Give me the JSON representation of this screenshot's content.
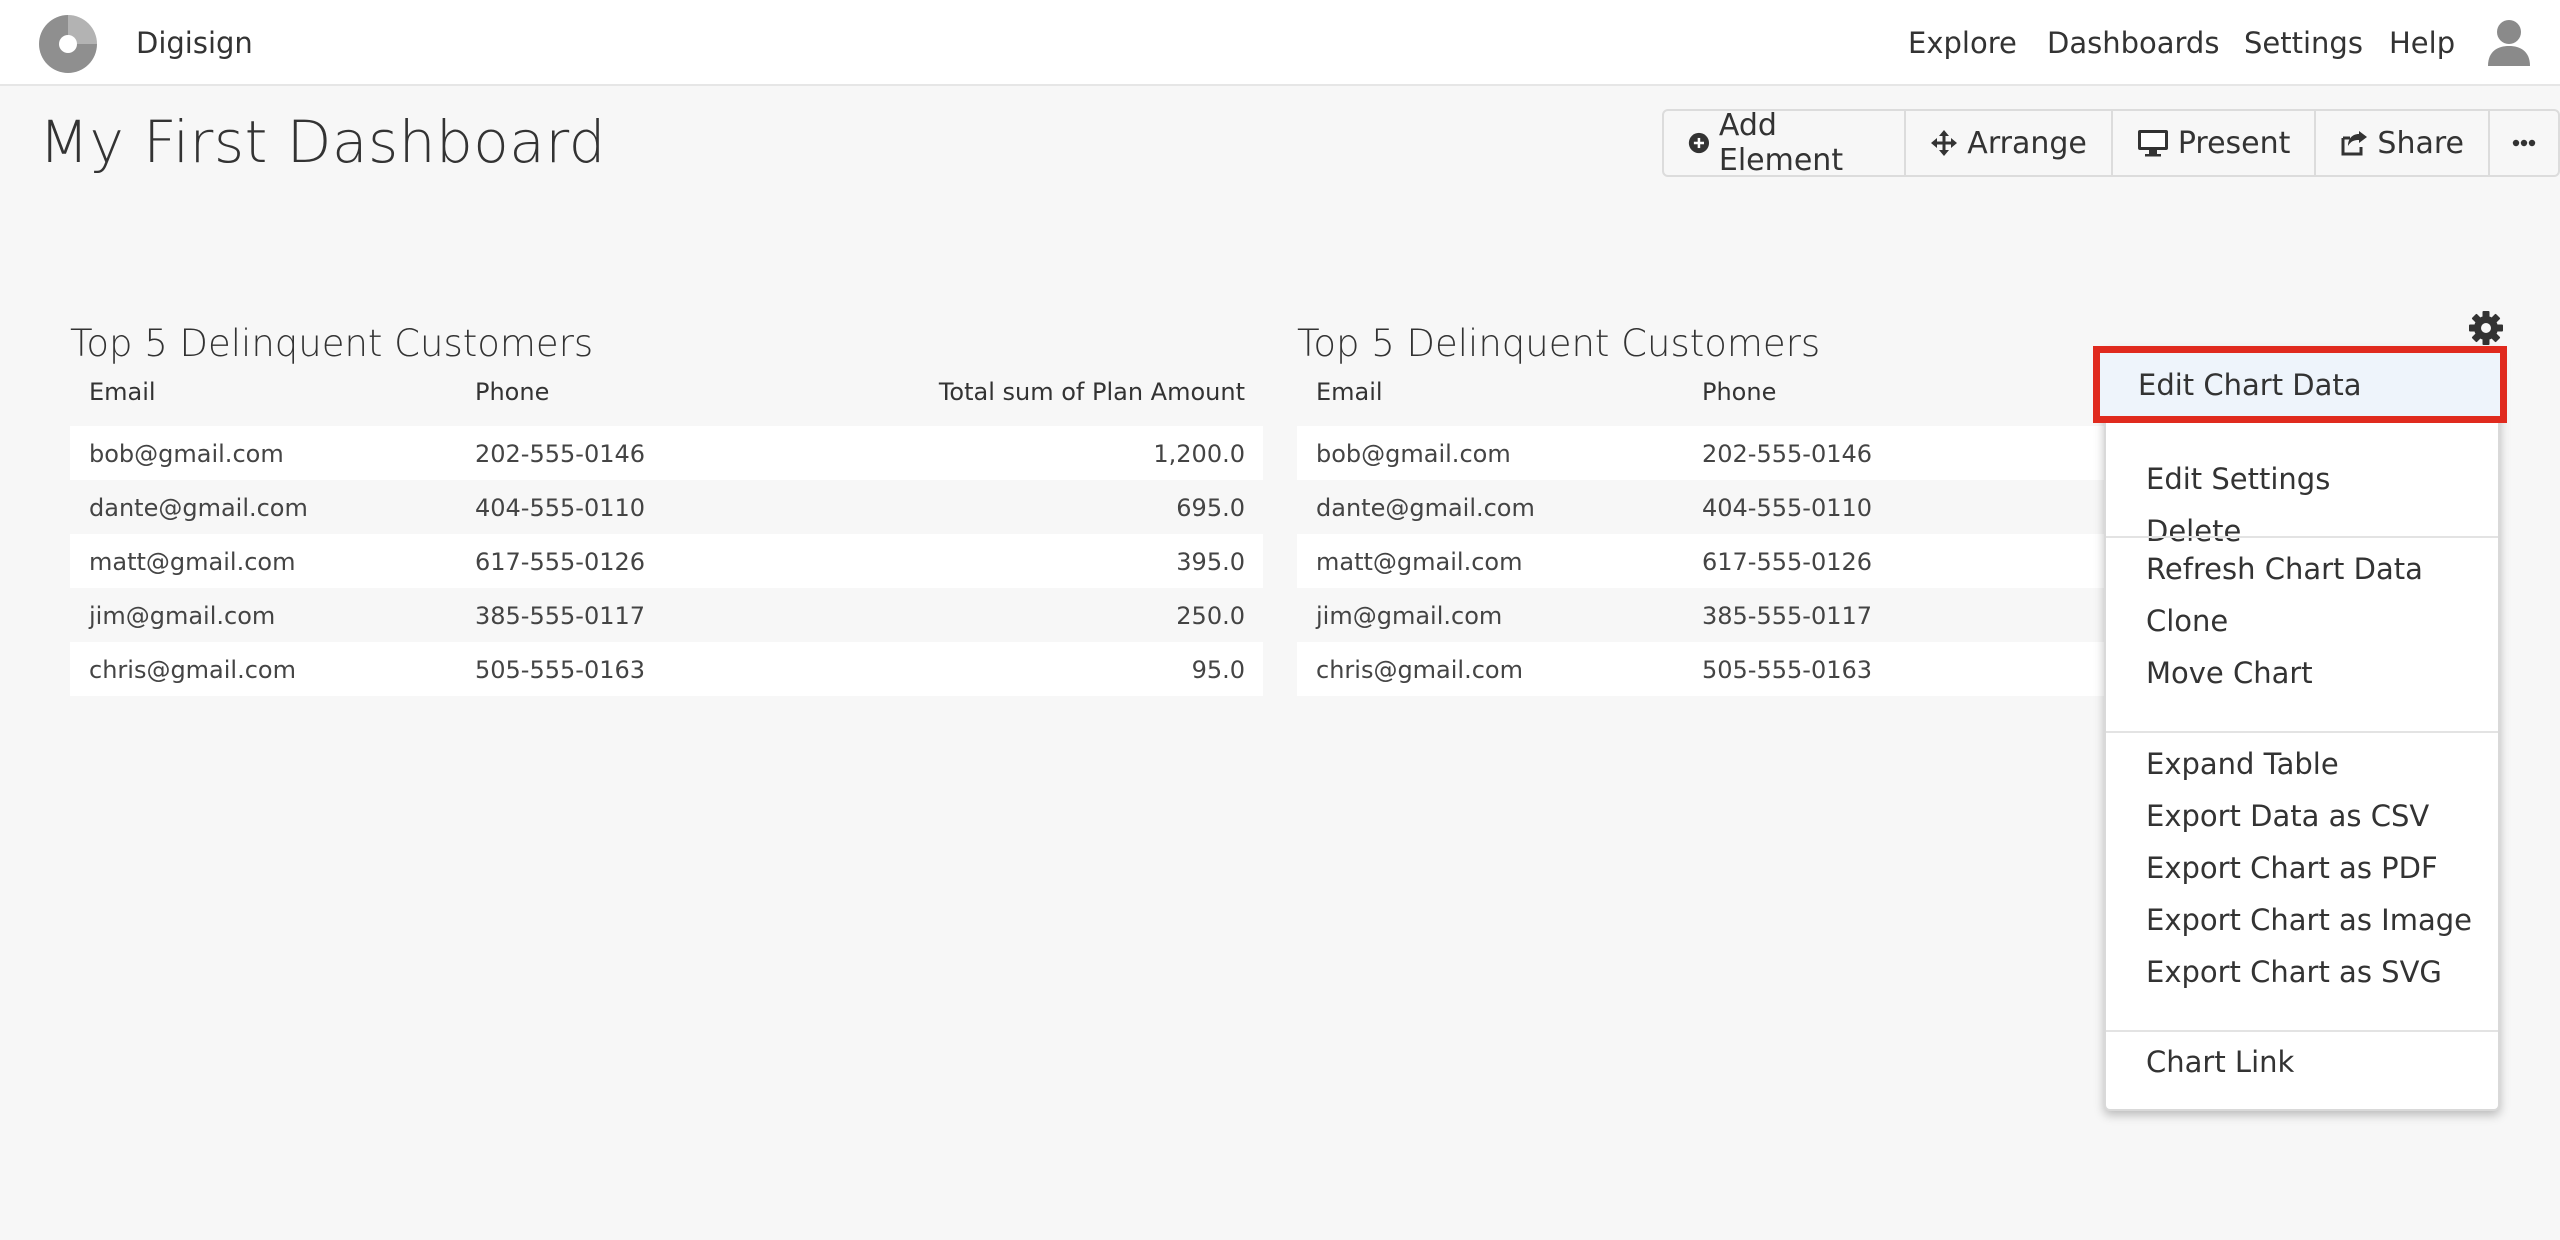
{
  "app": {
    "name": "Digisign"
  },
  "nav": {
    "explore": "Explore",
    "dashboards": "Dashboards",
    "settings": "Settings",
    "help": "Help"
  },
  "page": {
    "title": "My First Dashboard"
  },
  "toolbar": {
    "add_element": "Add Element",
    "arrange": "Arrange",
    "present": "Present",
    "share": "Share",
    "more": "···"
  },
  "widgets": [
    {
      "title": "Top 5 Delinquent Customers",
      "columns": [
        "Email",
        "Phone",
        "Total sum of Plan Amount"
      ],
      "rows": [
        [
          "bob@gmail.com",
          "202-555-0146",
          "1,200.0"
        ],
        [
          "dante@gmail.com",
          "404-555-0110",
          "695.0"
        ],
        [
          "matt@gmail.com",
          "617-555-0126",
          "395.0"
        ],
        [
          "jim@gmail.com",
          "385-555-0117",
          "250.0"
        ],
        [
          "chris@gmail.com",
          "505-555-0163",
          "95.0"
        ]
      ]
    },
    {
      "title": "Top 5 Delinquent Customers",
      "columns": [
        "Email",
        "Phone"
      ],
      "rows": [
        [
          "bob@gmail.com",
          "202-555-0146"
        ],
        [
          "dante@gmail.com",
          "404-555-0110"
        ],
        [
          "matt@gmail.com",
          "617-555-0126"
        ],
        [
          "jim@gmail.com",
          "385-555-0117"
        ],
        [
          "chris@gmail.com",
          "505-555-0163"
        ]
      ]
    }
  ],
  "menu": {
    "items": [
      "Edit Chart Data",
      "Edit Settings",
      "Delete",
      "Refresh Chart Data",
      "Clone",
      "Move Chart",
      "Expand Table",
      "Export Data as CSV",
      "Export Chart as PDF",
      "Export Chart as Image",
      "Export Chart as SVG",
      "Chart Link"
    ],
    "highlighted": "Edit Chart Data"
  },
  "colors": {
    "highlight_border": "#e02a1e",
    "background": "#f7f7f7"
  },
  "icons": {
    "logo": "pie-logo-icon",
    "user": "user-icon",
    "add": "plus-circle-icon",
    "arrange": "move-arrows-icon",
    "present": "monitor-icon",
    "share": "share-icon",
    "more": "ellipsis-icon",
    "settings": "gear-icon"
  }
}
